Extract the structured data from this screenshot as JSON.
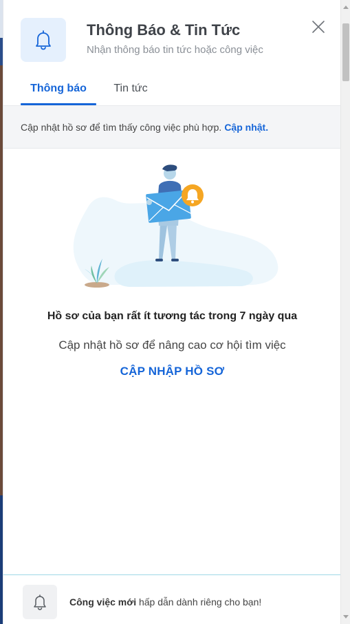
{
  "header": {
    "title": "Thông Báo & Tin Tức",
    "subtitle": "Nhận thông báo tin tức hoặc công việc",
    "icon": "bell-icon",
    "close_icon": "close-icon"
  },
  "tabs": [
    {
      "label": "Thông báo",
      "active": true
    },
    {
      "label": "Tin tức",
      "active": false
    }
  ],
  "banner": {
    "text": "Cập nhật hồ sơ để tìm thấy công việc phù hợp.",
    "link": "Cập nhật."
  },
  "empty_state": {
    "title": "Hồ sơ của bạn rất ít tương tác trong 7 ngày qua",
    "description": "Cập nhật hồ sơ để nâng cao cơ hội tìm việc",
    "cta": "CẬP NHẬP HỒ SƠ"
  },
  "footer": {
    "icon": "bell-icon",
    "bold_text": "Công việc mới",
    "text": " hấp dẫn dành riêng cho bạn!"
  },
  "colors": {
    "accent": "#1565d8",
    "icon_bg": "#e5f0fd",
    "notification_orange": "#f5a623"
  }
}
